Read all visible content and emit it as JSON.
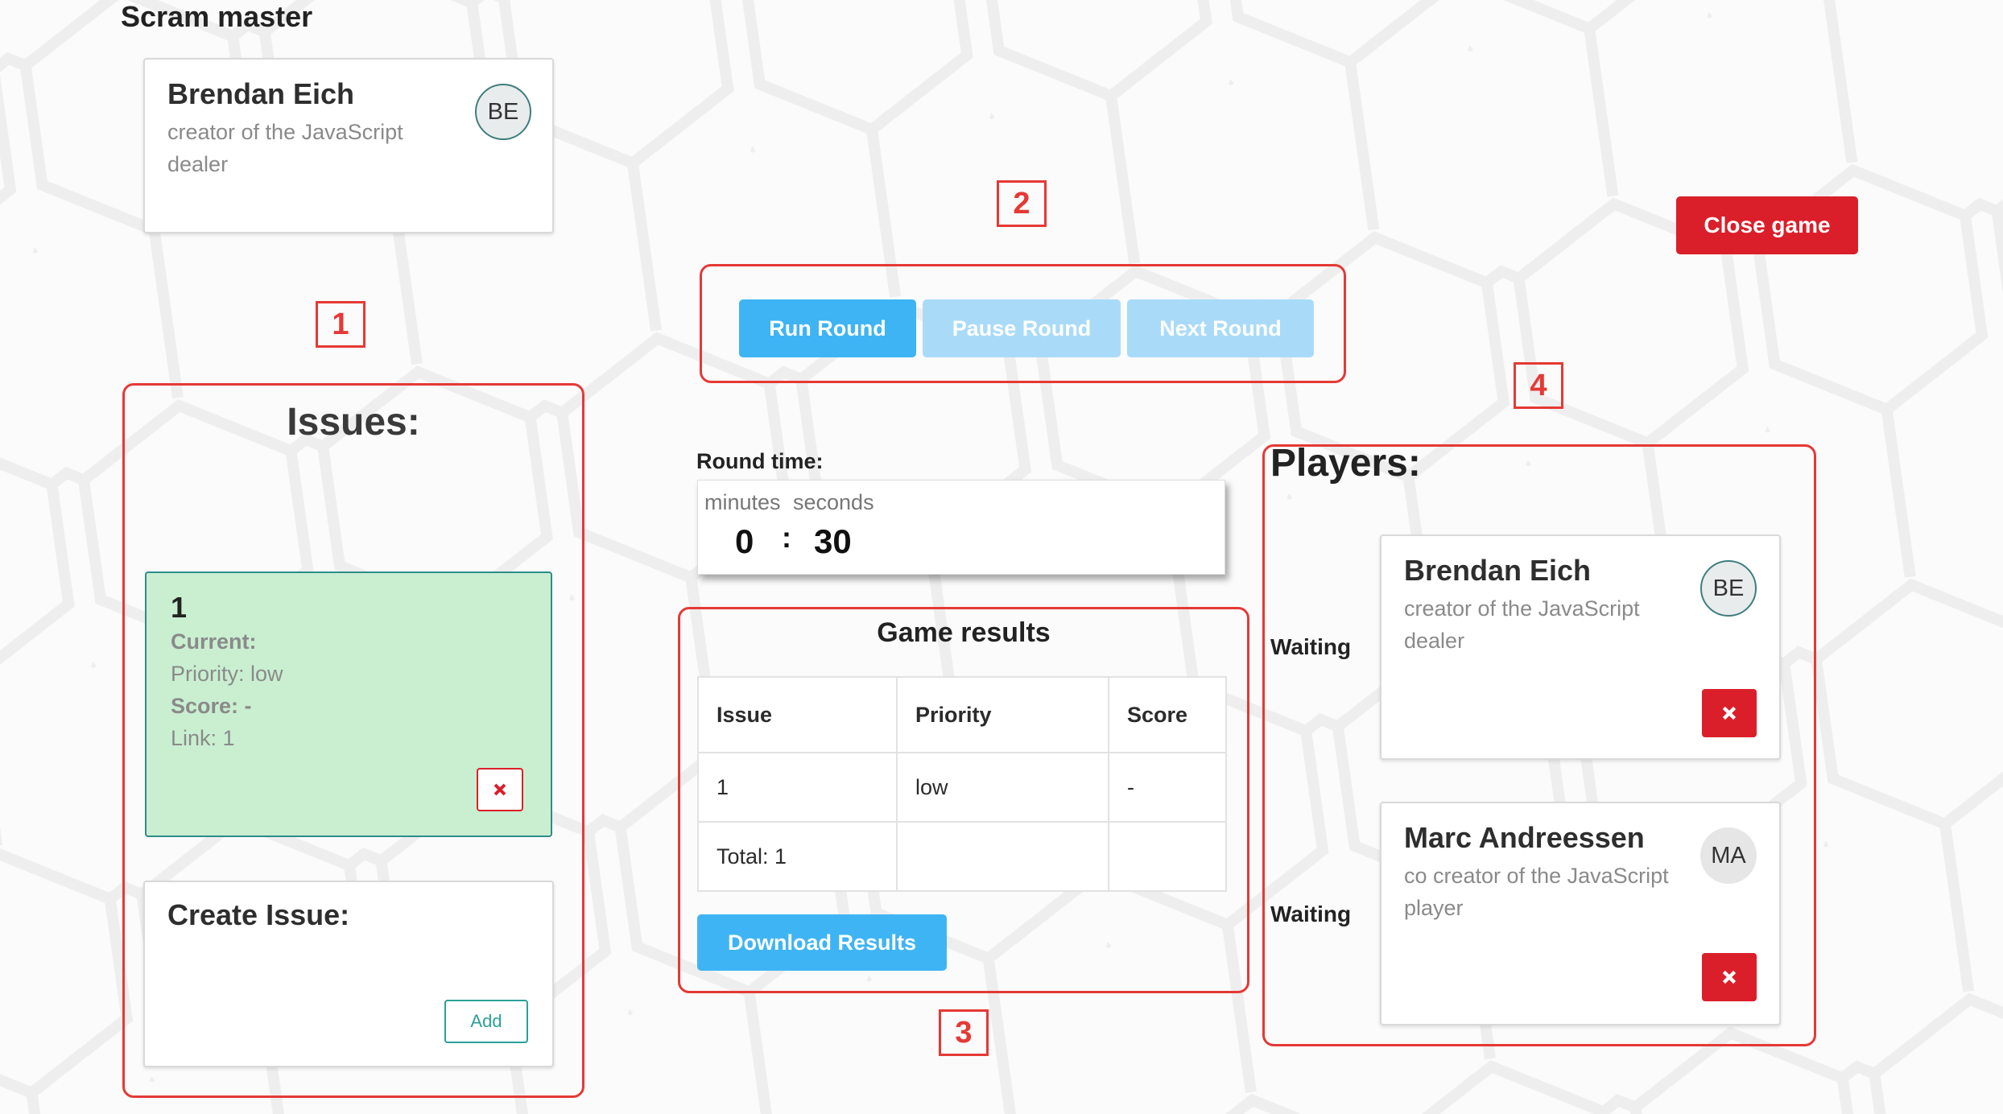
{
  "header": {
    "title": "Scram master"
  },
  "dealer": {
    "name": "Brendan Eich",
    "role": "creator of the JavaScript dealer",
    "initials": "BE"
  },
  "close_button": "Close game",
  "controls": {
    "run": "Run Round",
    "pause": "Pause Round",
    "next": "Next Round"
  },
  "issues": {
    "title": "Issues:",
    "items": [
      {
        "id": "1",
        "current": "Current:",
        "priority": "Priority: low",
        "score": "Score: -",
        "link": "Link: 1"
      }
    ],
    "create_title": "Create Issue:",
    "add_label": "Add"
  },
  "timer": {
    "label": "Round time:",
    "minutes_label": "minutes",
    "seconds_label": "seconds",
    "minutes": "0",
    "separator": ":",
    "seconds": "30"
  },
  "results": {
    "title": "Game results",
    "headers": [
      "Issue",
      "Priority",
      "Score"
    ],
    "rows": [
      [
        "1",
        "low",
        "-"
      ]
    ],
    "total": "Total: 1",
    "download": "Download Results"
  },
  "players": {
    "title": "Players:",
    "list": [
      {
        "status": "Waiting",
        "name": "Brendan Eich",
        "role": "creator of the JavaScript dealer",
        "initials": "BE"
      },
      {
        "status": "Waiting",
        "name": "Marc Andreessen",
        "role": "co creator of the JavaScript player",
        "initials": "MA"
      }
    ]
  },
  "markers": [
    "1",
    "2",
    "3",
    "4"
  ],
  "colors": {
    "accent_blue": "#3eb4f4",
    "danger_red": "#db1f2a",
    "issue_green": "#c9efd0",
    "annotation_red": "#e53935"
  }
}
